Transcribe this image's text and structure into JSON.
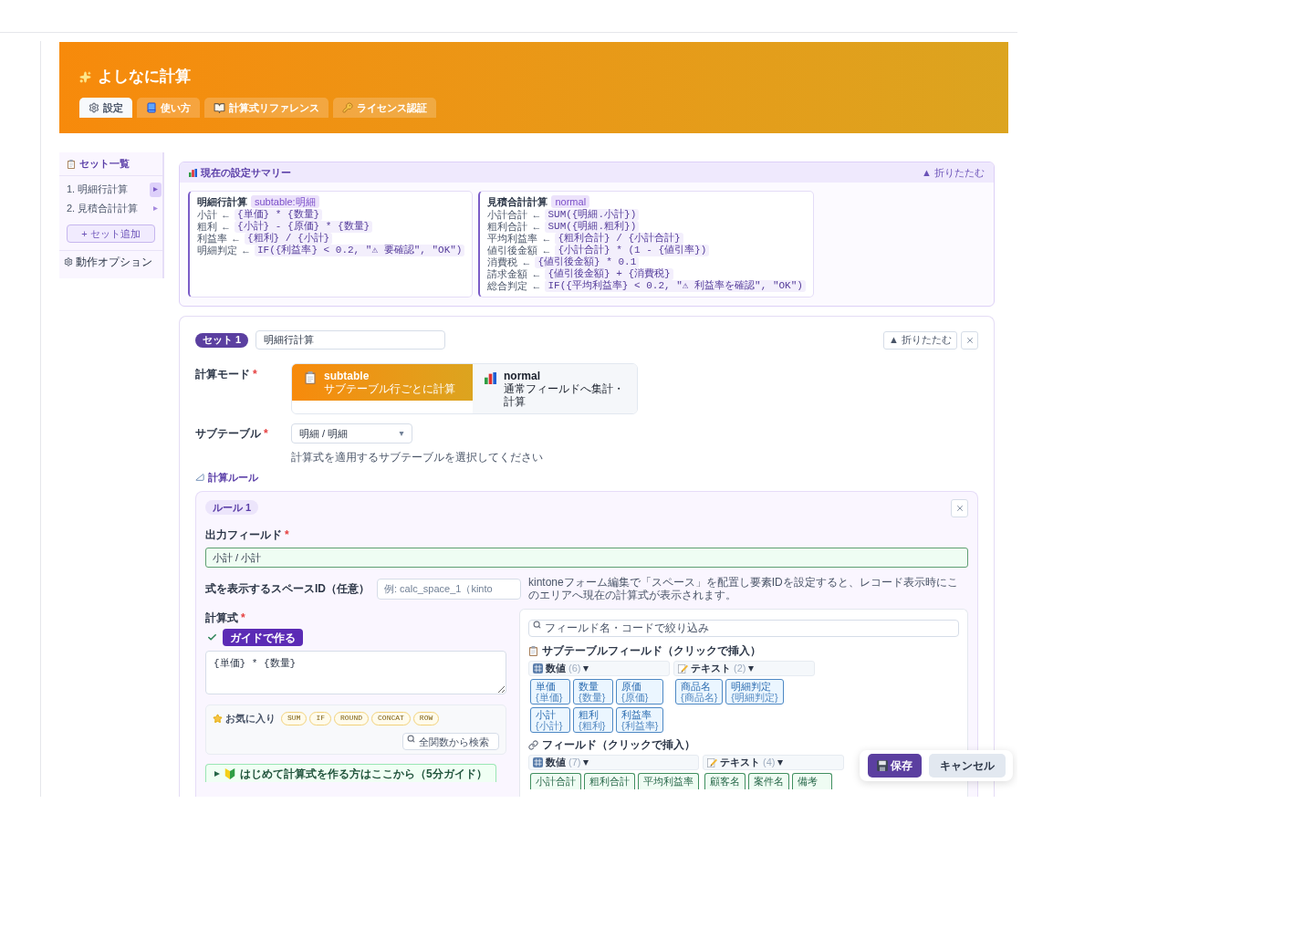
{
  "header": {
    "title": "よしなに計算",
    "tabs": [
      {
        "label": "設定",
        "kind": "gear",
        "selected": true
      },
      {
        "label": "使い方",
        "kind": "book",
        "selected": false
      },
      {
        "label": "計算式リファレンス",
        "kind": "open-book",
        "selected": false
      },
      {
        "label": "ライセンス認証",
        "kind": "key",
        "selected": false
      }
    ]
  },
  "sidebar": {
    "title": "セット一覧",
    "items": [
      {
        "label": "1. 明細行計算",
        "selected": true
      },
      {
        "label": "2. 見積合計計算",
        "selected": false
      }
    ],
    "add_button": "+ セット追加",
    "options_link": "動作オプション"
  },
  "summary": {
    "title": "現在の設定サマリー",
    "collapse": "▲ 折りたたむ",
    "cards": [
      {
        "name": "明細行計算",
        "badge": "subtable:明細",
        "lines": [
          {
            "field": "小計",
            "arrow": "←",
            "expr": "{単価} * {数量}"
          },
          {
            "field": "粗利",
            "arrow": "←",
            "expr": "{小計} - {原価} * {数量}"
          },
          {
            "field": "利益率",
            "arrow": "←",
            "expr": "{粗利} / {小計}"
          },
          {
            "field": "明細判定",
            "arrow": "←",
            "expr": "IF({利益率} < 0.2, \"⚠ 要確認\", \"OK\")"
          }
        ]
      },
      {
        "name": "見積合計計算",
        "badge": "normal",
        "lines": [
          {
            "field": "小計合計",
            "arrow": "←",
            "expr": "SUM({明細.小計})"
          },
          {
            "field": "粗利合計",
            "arrow": "←",
            "expr": "SUM({明細.粗利})"
          },
          {
            "field": "平均利益率",
            "arrow": "←",
            "expr": "{粗利合計} / {小計合計}"
          },
          {
            "field": "値引後金額",
            "arrow": "←",
            "expr": "{小計合計} * (1 - {値引率})"
          },
          {
            "field": "消費税",
            "arrow": "←",
            "expr": "{値引後金額} * 0.1"
          },
          {
            "field": "請求金額",
            "arrow": "←",
            "expr": "{値引後金額} + {消費税}"
          },
          {
            "field": "総合判定",
            "arrow": "←",
            "expr": "IF({平均利益率} < 0.2, \"⚠ 利益率を確認\", \"OK\")"
          }
        ]
      }
    ]
  },
  "set": {
    "badge": "セット 1",
    "name": "明細行計算",
    "collapse": "▲ 折りたたむ",
    "calc_mode": {
      "label": "計算モード",
      "required_mark": "*",
      "options": [
        {
          "title": "subtable",
          "description": "サブテーブル行ごとに計算",
          "kind": "table",
          "selected": true
        },
        {
          "title": "normal",
          "description": "通常フィールドへ集計・計算",
          "kind": "chart",
          "selected": false
        }
      ]
    },
    "subtable": {
      "label": "サブテーブル",
      "required_mark": "*",
      "value": "明細 / 明細",
      "hint": "計算式を適用するサブテーブルを選択してください"
    },
    "rules_title": "計算ルール",
    "rule": {
      "badge": "ルール 1",
      "output": {
        "label": "出力フィールド",
        "required_mark": "*",
        "value": "小計 / 小計"
      },
      "space_id": {
        "label": "式を表示するスペースID（任意）",
        "placeholder": "例: calc_space_1（kinto",
        "help": "kintoneフォーム編集で「スペース」を配置し要素IDを設定すると、レコード表示時にこのエリアへ現在の計算式が表示されます。"
      },
      "formula": {
        "label": "計算式",
        "required_mark": "*",
        "valid": true,
        "guide_button": "ガイドで作る",
        "value": "{単価} * {数量}"
      },
      "favorites": {
        "label": "お気に入り",
        "functions": [
          "SUM",
          "IF",
          "ROUND",
          "CONCAT",
          "ROW"
        ],
        "search_placeholder": "全関数から検索"
      },
      "guide": {
        "label": "はじめて計算式を作る方はここから（5分ガイド）",
        "expanded": false
      },
      "field_picker": {
        "search_placeholder": "フィールド名・コードで絞り込み",
        "sections": [
          {
            "title": "サブテーブルフィールド（クリックで挿入）",
            "kind": "subtable",
            "groups": [
              {
                "label": "数値",
                "count": "(6)",
                "kind": "number",
                "expanded": true,
                "fields": [
                  {
                    "name": "単価",
                    "code": "{単価}"
                  },
                  {
                    "name": "数量",
                    "code": "{数量}"
                  },
                  {
                    "name": "原価",
                    "code": "{原価}"
                  },
                  {
                    "name": "小計",
                    "code": "{小計}"
                  },
                  {
                    "name": "粗利",
                    "code": "{粗利}"
                  },
                  {
                    "name": "利益率",
                    "code": "{利益率}"
                  }
                ]
              },
              {
                "label": "テキスト",
                "count": "(2)",
                "kind": "text",
                "expanded": true,
                "fields": [
                  {
                    "name": "商品名",
                    "code": "{商品名}"
                  },
                  {
                    "name": "明細判定",
                    "code": "{明細判定}"
                  }
                ]
              }
            ]
          },
          {
            "title": "フィールド（クリックで挿入）",
            "kind": "form",
            "groups": [
              {
                "label": "数値",
                "count": "(7)",
                "kind": "number",
                "expanded": true,
                "fields": [
                  {
                    "name": "小計合計"
                  },
                  {
                    "name": "粗利合計"
                  },
                  {
                    "name": "平均利益率"
                  }
                ]
              },
              {
                "label": "テキスト",
                "count": "(4)",
                "kind": "text",
                "expanded": true,
                "fields": [
                  {
                    "name": "顧客名"
                  },
                  {
                    "name": "案件名"
                  },
                  {
                    "name": "備考"
                  }
                ]
              }
            ]
          }
        ]
      }
    }
  },
  "save_bar": {
    "save": "保存",
    "cancel": "キャンセル"
  }
}
